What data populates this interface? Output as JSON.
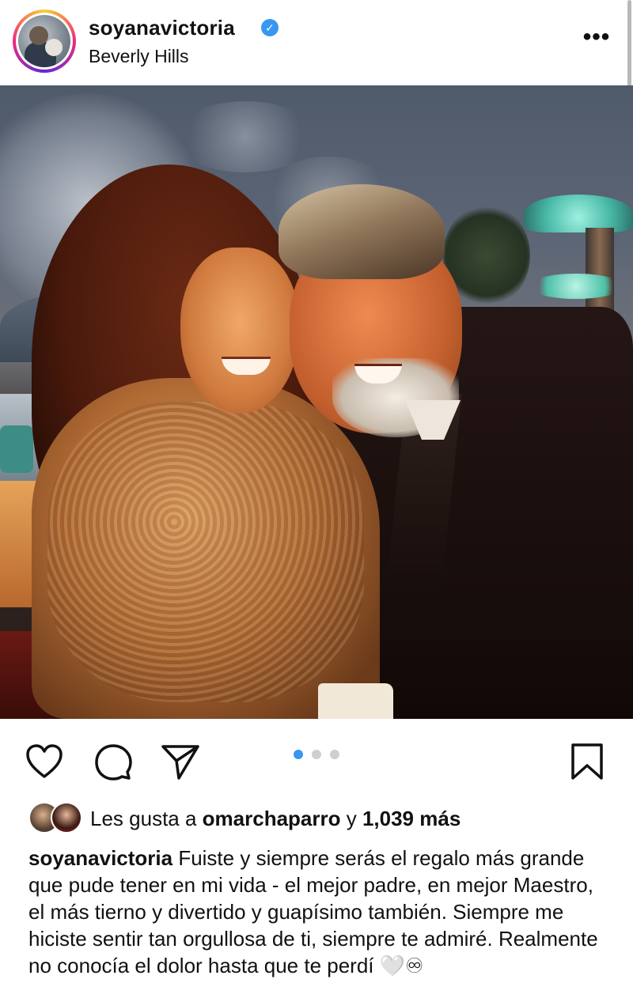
{
  "post": {
    "username": "soyanavictoria",
    "location": "Beverly Hills",
    "verified": true,
    "more_label": "•••"
  },
  "actions": {
    "like_icon": "heart-icon",
    "comment_icon": "comment-icon",
    "share_icon": "send-icon",
    "save_icon": "bookmark-icon"
  },
  "carousel": {
    "total": 3,
    "active": 1,
    "active_color": "#3897f0"
  },
  "likes": {
    "prefix": "Les gusta a ",
    "user": "omarchaparro",
    "middle": " y ",
    "count": "1,039 más"
  },
  "caption": {
    "username": "soyanavictoria",
    "text": " Fuiste y siempre serás el regalo más grande que pude tener en mi vida - el mejor padre, en mejor Maestro, el más tierno y divertido y guapísimo también. Siempre me hiciste sentir tan orgullosa de ti, siempre te admiré. Realmente no conocía el dolor hasta que te perdí 🤍♾"
  },
  "colors": {
    "verified": "#3897f0",
    "ring_start": "#f9ce34",
    "ring_mid": "#ee2a7b",
    "ring_end": "#6228d7"
  }
}
